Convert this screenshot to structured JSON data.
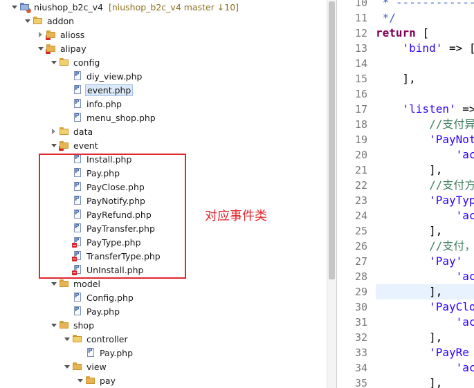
{
  "project_tree": {
    "root": {
      "label": "niushop_b2c_v4",
      "decoration": "[niushop_b2c_v4 master ↓10]"
    },
    "nodes": [
      {
        "label": "addon",
        "kind": "folder",
        "level": 1,
        "twisty": "expanded"
      },
      {
        "label": "alioss",
        "kind": "package",
        "level": 2,
        "twisty": "collapsed",
        "error": true
      },
      {
        "label": "alipay",
        "kind": "package",
        "level": 2,
        "twisty": "expanded",
        "error": true
      },
      {
        "label": "config",
        "kind": "folder",
        "level": 3,
        "twisty": "expanded"
      },
      {
        "label": "diy_view.php",
        "kind": "php",
        "level": 4
      },
      {
        "label": "event.php",
        "kind": "php",
        "level": 4,
        "selected": true
      },
      {
        "label": "info.php",
        "kind": "php",
        "level": 4
      },
      {
        "label": "menu_shop.php",
        "kind": "php",
        "level": 4
      },
      {
        "label": "data",
        "kind": "folder",
        "level": 3,
        "twisty": "collapsed"
      },
      {
        "label": "event",
        "kind": "package",
        "level": 3,
        "twisty": "expanded",
        "error": true
      },
      {
        "label": "Install.php",
        "kind": "php",
        "level": 4
      },
      {
        "label": "Pay.php",
        "kind": "php",
        "level": 4
      },
      {
        "label": "PayClose.php",
        "kind": "php",
        "level": 4
      },
      {
        "label": "PayNotify.php",
        "kind": "php",
        "level": 4
      },
      {
        "label": "PayRefund.php",
        "kind": "php",
        "level": 4
      },
      {
        "label": "PayTransfer.php",
        "kind": "php",
        "level": 4
      },
      {
        "label": "PayType.php",
        "kind": "php",
        "level": 4,
        "error": true
      },
      {
        "label": "TransferType.php",
        "kind": "php",
        "level": 4,
        "error": true
      },
      {
        "label": "UnInstall.php",
        "kind": "php",
        "level": 4,
        "error": true
      },
      {
        "label": "model",
        "kind": "package",
        "level": 3,
        "twisty": "expanded"
      },
      {
        "label": "Config.php",
        "kind": "php",
        "level": 4
      },
      {
        "label": "Pay.php",
        "kind": "php",
        "level": 4
      },
      {
        "label": "shop",
        "kind": "package",
        "level": 3,
        "twisty": "expanded"
      },
      {
        "label": "controller",
        "kind": "folder",
        "level": 4,
        "twisty": "expanded"
      },
      {
        "label": "Pay.php",
        "kind": "php",
        "level": 5
      },
      {
        "label": "view",
        "kind": "package",
        "level": 4,
        "twisty": "expanded"
      },
      {
        "label": "pay",
        "kind": "package",
        "level": 5,
        "twisty": "expanded"
      }
    ]
  },
  "annotation": {
    "text": "对应事件类",
    "color": "#e0262d"
  },
  "editor": {
    "highlight_line": 29,
    "lines": [
      {
        "n": "10",
        "text": " * -----------------------"
      },
      {
        "n": "11",
        "text": " */"
      },
      {
        "n": "12",
        "text": "return ["
      },
      {
        "n": "13",
        "text": "    'bind' => ["
      },
      {
        "n": "14",
        "text": ""
      },
      {
        "n": "15",
        "text": "    ],"
      },
      {
        "n": "16",
        "text": ""
      },
      {
        "n": "17",
        "text": "    'listen' => ["
      },
      {
        "n": "18",
        "text": "        //支付异"
      },
      {
        "n": "19",
        "text": "        'PayNot"
      },
      {
        "n": "20",
        "text": "            'ac"
      },
      {
        "n": "21",
        "text": "        ],"
      },
      {
        "n": "22",
        "text": "        //支付方"
      },
      {
        "n": "23",
        "text": "        'PayTyp"
      },
      {
        "n": "24",
        "text": "            'ac"
      },
      {
        "n": "25",
        "text": "        ],"
      },
      {
        "n": "26",
        "text": "        //支付，"
      },
      {
        "n": "27",
        "text": "        'Pay' "
      },
      {
        "n": "28",
        "text": "            'ac"
      },
      {
        "n": "29",
        "text": "        ],"
      },
      {
        "n": "30",
        "text": "        'PayClo"
      },
      {
        "n": "31",
        "text": "            'ac"
      },
      {
        "n": "32",
        "text": "        ],"
      },
      {
        "n": "33",
        "text": "        'PayRe"
      },
      {
        "n": "34",
        "text": "            'ac"
      },
      {
        "n": "35",
        "text": "        ],"
      }
    ]
  },
  "colors": {
    "keyword": "#7f0055",
    "string": "#2a00ff",
    "comment": "#3f7f5f",
    "annotation": "#e0262d"
  }
}
